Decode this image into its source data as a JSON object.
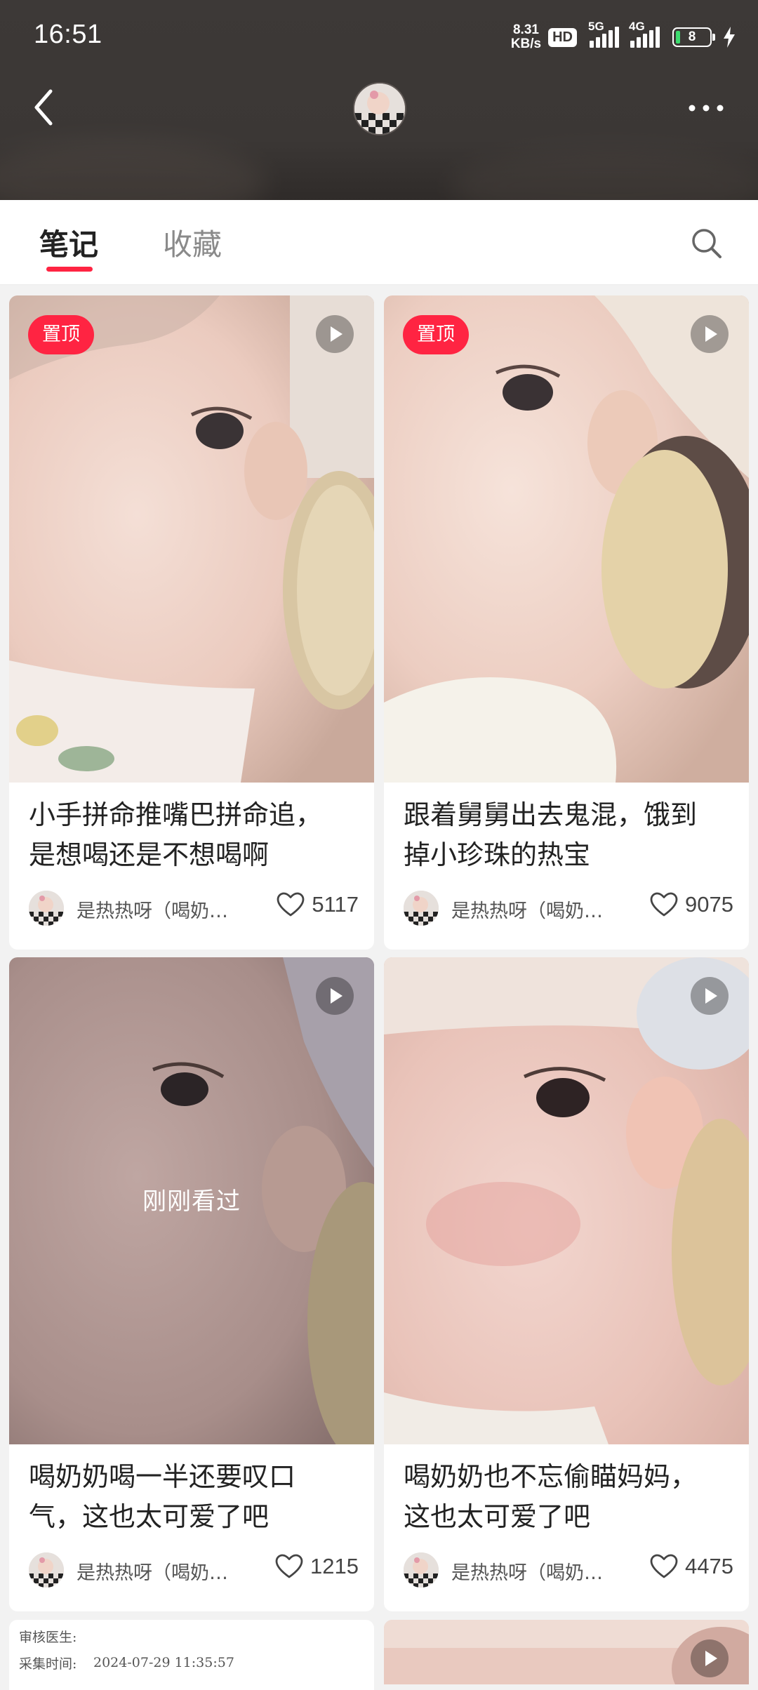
{
  "status_bar": {
    "time": "16:51",
    "net_speed_value": "8.31",
    "net_speed_unit": "KB/s",
    "hd_badge": "HD",
    "signal_1_label": "5G",
    "signal_2_label": "4G",
    "battery_level": "8"
  },
  "header": {
    "back_icon": "chevron-left-icon",
    "more_icon": "more-dots-icon"
  },
  "tabs": [
    {
      "label": "笔记",
      "active": true
    },
    {
      "label": "收藏",
      "active": false
    }
  ],
  "feed": {
    "cards": [
      {
        "pinned_label": "置顶",
        "title_line1": "小手拼命推嘴巴拼命追，",
        "title_line2": "是想喝还是不想喝啊",
        "author": "是热热呀（喝奶…",
        "likes": "5117"
      },
      {
        "pinned_label": "置顶",
        "title_line1": "跟着舅舅出去鬼混，饿到",
        "title_line2": "掉小珍珠的热宝",
        "author": "是热热呀（喝奶…",
        "likes": "9075"
      },
      {
        "overlay_text": "刚刚看过",
        "title_line1": "喝奶奶喝一半还要叹口",
        "title_line2": "气，这也太可爱了吧",
        "author": "是热热呀（喝奶…",
        "likes": "1215"
      },
      {
        "title_line1": "喝奶奶也不忘偷瞄妈妈，",
        "title_line2": "这也太可爱了吧",
        "author": "是热热呀（喝奶…",
        "likes": "4475"
      }
    ],
    "partial_meta": {
      "reviewer_label": "审核医生:",
      "collect_time_label": "采集时间:",
      "collect_time_value": "2024-07-29 11:35:57"
    }
  }
}
